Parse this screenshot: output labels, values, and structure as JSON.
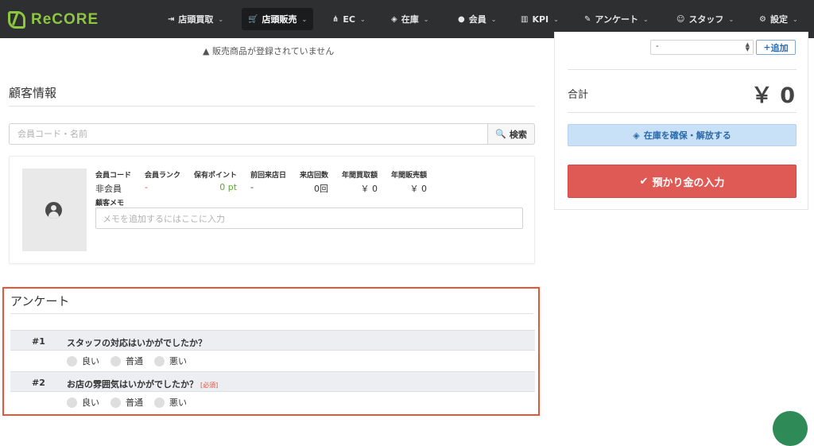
{
  "brand": {
    "name": "ReCORE"
  },
  "nav": [
    {
      "icon": "⇥",
      "label": "店頭買取",
      "icon_name": "sign-in-icon"
    },
    {
      "icon": "🛒",
      "label": "店頭販売",
      "icon_name": "cart-icon",
      "active": true
    },
    {
      "icon": "⋔",
      "label": "EC",
      "icon_name": "sitemap-icon"
    },
    {
      "icon": "◈",
      "label": "在庫",
      "icon_name": "cubes-icon"
    },
    {
      "icon": "●",
      "label": "会員",
      "icon_name": "user-icon"
    },
    {
      "icon": "▥",
      "label": "KPI",
      "icon_name": "bar-chart-icon"
    },
    {
      "icon": "✎",
      "label": "アンケート",
      "icon_name": "edit-icon"
    },
    {
      "icon": "☺",
      "label": "スタッフ",
      "icon_name": "staff-user-icon"
    },
    {
      "icon": "⚙",
      "label": "設定",
      "icon_name": "gear-icon"
    }
  ],
  "sales": {
    "empty_message": "販売商品が登録されていません",
    "warning_icon": "▲"
  },
  "customer": {
    "section_title": "顧客情報",
    "search_placeholder": "会員コード・名前",
    "search_button": "検索",
    "search_icon": "🔍",
    "stats": [
      {
        "label": "会員コード",
        "value": "非会員"
      },
      {
        "label": "会員ランク",
        "value": "-"
      },
      {
        "label": "保有ポイント",
        "value": "0 pt"
      },
      {
        "label": "前回来店日",
        "value": "-"
      },
      {
        "label": "来店回数",
        "value": "0回"
      },
      {
        "label": "年間買取額",
        "value": "￥ 0"
      },
      {
        "label": "年間販売額",
        "value": "￥ 0"
      }
    ],
    "memo_label": "顧客メモ",
    "memo_placeholder": "メモを追加するにはここに入力"
  },
  "survey": {
    "title": "アンケート",
    "questions": [
      {
        "num": "#1",
        "text": "スタッフの対応はいかがでしたか？",
        "required": "",
        "options": [
          "良い",
          "普通",
          "悪い"
        ]
      },
      {
        "num": "#2",
        "text": "お店の雰囲気はいかがでしたか？",
        "required": "[必須]",
        "options": [
          "良い",
          "普通",
          "悪い"
        ]
      }
    ]
  },
  "right": {
    "select_value": "-",
    "add_button": "追加",
    "add_icon": "+",
    "total_label": "合計",
    "total_value": "￥ 0",
    "stock_button": "在庫を確保・解放する",
    "stock_icon": "◈",
    "deposit_button": "預かり金の入力",
    "deposit_icon": "✔"
  },
  "colors": {
    "brand": "#8dc63f",
    "navbar": "#2d2f31",
    "highlight_border": "#e8563a",
    "deposit": "#e05a55",
    "stock": "#c8e1f6",
    "points": "#5aa832",
    "rank": "#e74c3c"
  }
}
